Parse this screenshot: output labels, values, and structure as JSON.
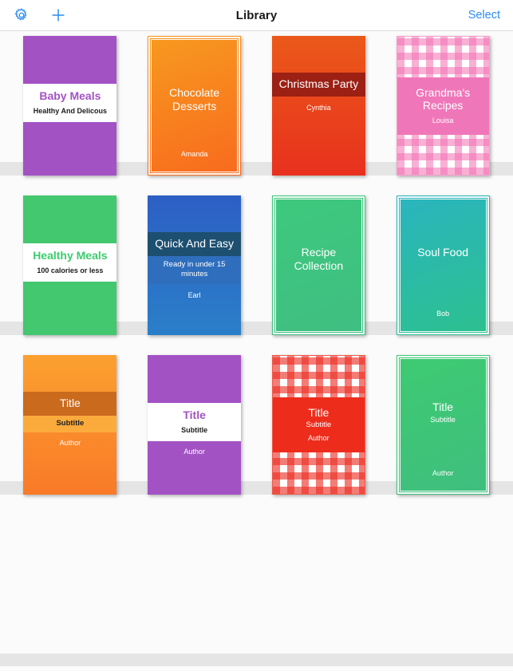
{
  "header": {
    "title": "Library",
    "select_label": "Select",
    "settings_icon": "gear-icon",
    "add_icon": "plus-icon",
    "accent_color": "#2b8cf0"
  },
  "shelves": [
    {
      "books": [
        {
          "style": "band",
          "title": "Baby Meals",
          "subtitle": "Healthy And Delicous",
          "author": "",
          "cover_color": "#a352c4",
          "title_color": "#a352c4"
        },
        {
          "style": "frame",
          "title": "Chocolate Desserts",
          "subtitle": "",
          "author": "Amanda",
          "cover_color": "#f79a1f",
          "cover_color2": "#f86a1e",
          "title_color": "#ffffff"
        },
        {
          "style": "darkband",
          "title": "Christmas Party",
          "subtitle": "",
          "author": "Cynthia",
          "cover_color": "#ea5919",
          "cover_color2": "#e8311e",
          "band_color": "#9c2014",
          "title_color": "#ffffff"
        },
        {
          "style": "gingham-pink",
          "title": "Grandma's Recipes",
          "subtitle": "",
          "author": "Louisa",
          "plate_color": "#ef77b9",
          "title_color": "#ffffff"
        }
      ]
    },
    {
      "books": [
        {
          "style": "band",
          "title": "Healthy Meals",
          "subtitle": "100 calories or less",
          "author": "",
          "cover_color": "#43c76f",
          "title_color": "#3ecb70"
        },
        {
          "style": "darkband",
          "title": "Quick And Easy",
          "subtitle": "Ready in under 15 minutes",
          "author": "Earl",
          "cover_color": "#2d5fc4",
          "cover_color2": "#2a7fc9",
          "band_color": "#1d4f70",
          "subband_color": "#2f6ebd",
          "title_color": "#ffffff"
        },
        {
          "style": "frame",
          "title": "Recipe Collection",
          "subtitle": "",
          "author": "",
          "cover_color": "#3ec97d",
          "cover_color2": "#3fbe82",
          "title_color": "#ffffff"
        },
        {
          "style": "frame",
          "title": "Soul Food",
          "subtitle": "",
          "author": "Bob",
          "cover_color": "#2ab5bf",
          "cover_color2": "#2dc08e",
          "title_color": "#ffffff"
        }
      ]
    },
    {
      "books": [
        {
          "style": "twoband",
          "title": "Title",
          "subtitle": "Subtitle",
          "author": "Author",
          "cover_color": "#fba030",
          "cover_color2": "#f97a28",
          "band_color": "#c96a1d",
          "subband_color": "#fbab3c",
          "title_color": "#ffffff"
        },
        {
          "style": "band",
          "title": "Title",
          "subtitle": "Subtitle",
          "author": "Author",
          "cover_color": "#a352c4",
          "title_color": "#a352c4"
        },
        {
          "style": "gingham-red",
          "title": "Title",
          "subtitle": "Subtitle",
          "author": "Author",
          "plate_color": "#ee2c1c",
          "title_color": "#ffffff"
        },
        {
          "style": "frame",
          "title": "Title",
          "subtitle": "Subtitle",
          "author": "Author",
          "cover_color": "#3ecb72",
          "cover_color2": "#3fbe7e",
          "title_color": "#ffffff"
        }
      ]
    }
  ]
}
